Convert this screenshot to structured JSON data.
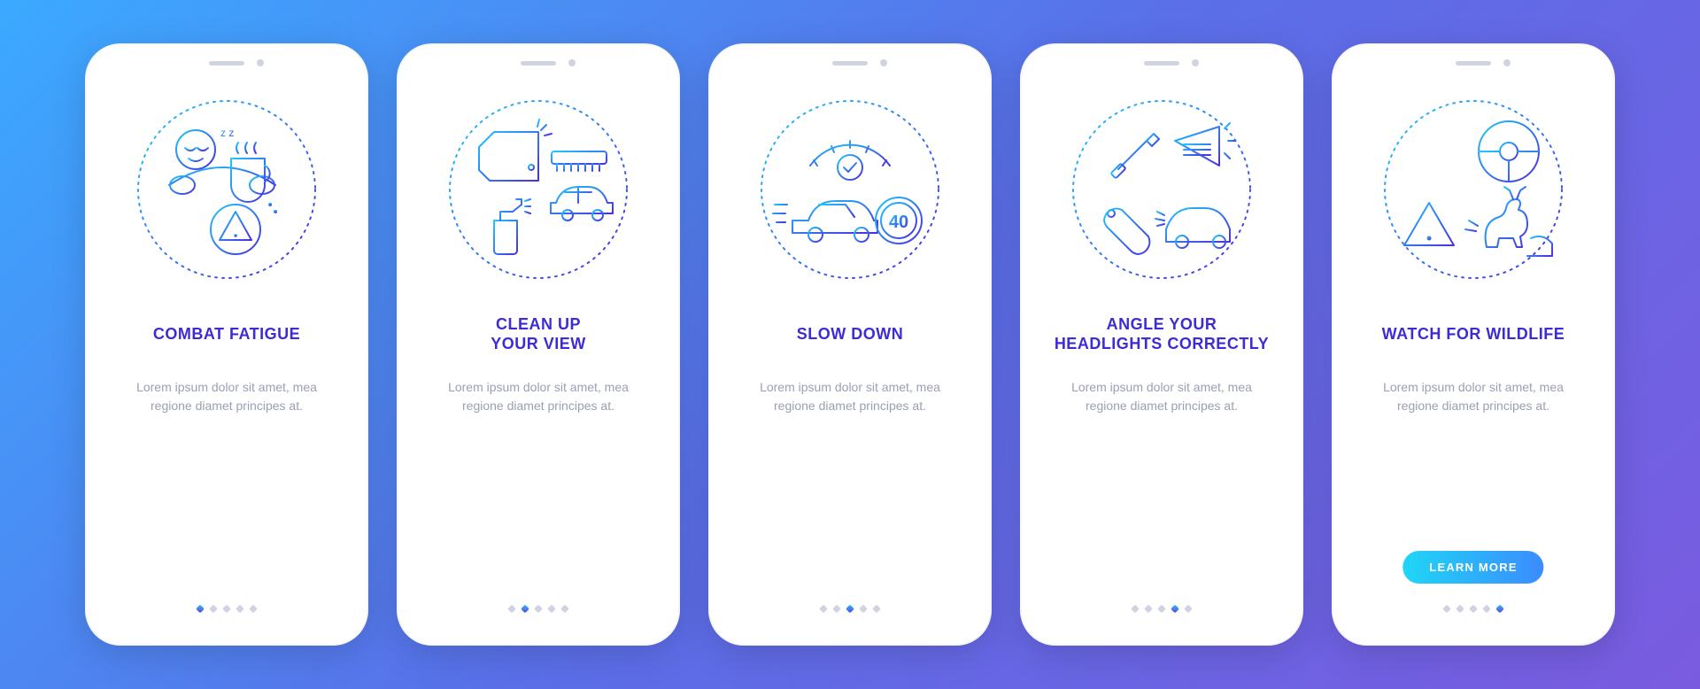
{
  "cta_label": "LEARN MORE",
  "body_text": "Lorem ipsum dolor sit amet, mea regione diamet principes at.",
  "page_count": 5,
  "screens": [
    {
      "title": "COMBAT FATIGUE",
      "icon": "fatigue-icon",
      "active_index": 0
    },
    {
      "title": "CLEAN UP\nYOUR VIEW",
      "icon": "clean-view-icon",
      "active_index": 1
    },
    {
      "title": "SLOW DOWN",
      "icon": "slow-down-icon",
      "active_index": 2
    },
    {
      "title": "ANGLE YOUR\nHEADLIGHTS CORRECTLY",
      "icon": "headlights-icon",
      "active_index": 3
    },
    {
      "title": "WATCH FOR WILDLIFE",
      "icon": "wildlife-icon",
      "active_index": 4
    }
  ]
}
